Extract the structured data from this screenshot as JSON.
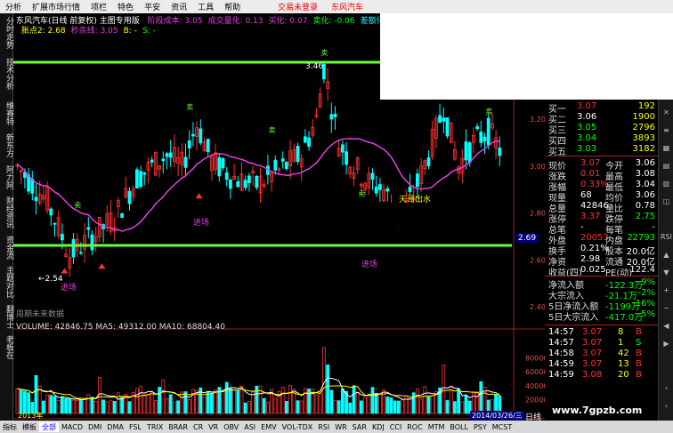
{
  "menu": {
    "items": [
      "分析",
      "扩展市场行情",
      "项栏",
      "特色",
      "平安",
      "资讯",
      "工具",
      "帮助"
    ],
    "right_items": [
      "交易未登录",
      "东风汽车"
    ]
  },
  "left_tabs": [
    "分时走势",
    "技术分析",
    "维赛特",
    "新东方",
    "阿力阿",
    "财经资讯",
    "资金流",
    "主题对比",
    "翻博士",
    "老板在"
  ],
  "chart": {
    "title": "东风汽车(日线 前复权) 主图专用版",
    "indicators_line1": [
      {
        "label": "阶段成本: 3.05",
        "color": "#e040e0"
      },
      {
        "label": "成交量化: 0.13",
        "color": "#e040e0"
      },
      {
        "label": "买化: 0.07",
        "color": "#e040e0"
      },
      {
        "label": "卖化: -0.06",
        "color": "#00ff00"
      },
      {
        "label": "差额化: 0.13",
        "color": "#00ffff"
      },
      {
        "label": "买卖额比: 1.33",
        "color": "#ffffff"
      },
      {
        "label": "项",
        "color": "#ffffff"
      }
    ],
    "indicators_line2": [
      {
        "label": "胀点2: 2.68",
        "color": "#ffff00"
      },
      {
        "label": "秒杀线: 3.05",
        "color": "#e040e0"
      },
      {
        "label": "B: -",
        "color": "#ffff00"
      },
      {
        "label": "S: -",
        "color": "#00ff00"
      }
    ],
    "price_axis": [
      "3.20",
      "3.00",
      "2.80",
      "2.69",
      "2.60",
      "2.40"
    ],
    "annotations": {
      "high": "3.46",
      "low": "←2.54",
      "entry1": "进场",
      "entry2": "进场",
      "exit": "天哥出水",
      "future": "周期未来数据",
      "buy_label": "买",
      "sell_label": "卖"
    },
    "volume_label": "VOLUME: 42846.75  MA5: 49312.00  MA10: 68804.40",
    "volume_axis": [
      "80000",
      "60000",
      "40000",
      "20000"
    ],
    "date_start": "2013年",
    "date_end": "2014/03/26/三",
    "period": "日线"
  },
  "quote": {
    "order_book": [
      {
        "label": "买一",
        "price": "3.07",
        "vol": "192"
      },
      {
        "label": "买二",
        "price": "3.06",
        "vol": "1900"
      },
      {
        "label": "买三",
        "price": "3.05",
        "vol": "2796"
      },
      {
        "label": "买四",
        "price": "3.04",
        "vol": "3893"
      },
      {
        "label": "买五",
        "price": "3.03",
        "vol": "3182"
      }
    ],
    "stats": [
      {
        "l1": "现价",
        "v1": "3.07",
        "l2": "今开",
        "v2": "3.06"
      },
      {
        "l1": "涨跌",
        "v1": "0.01",
        "l2": "最高",
        "v2": "3.08"
      },
      {
        "l1": "涨幅",
        "v1": "0.33%",
        "l2": "最低",
        "v2": "3.04"
      },
      {
        "l1": "现量",
        "v1": "68",
        "l2": "均价",
        "v2": "3.06"
      },
      {
        "l1": "总量",
        "v1": "42846",
        "l2": "量比",
        "v2": "0.78"
      },
      {
        "l1": "涨停",
        "v1": "3.37",
        "l2": "跌停",
        "v2": "2.75"
      },
      {
        "l1": "总笔",
        "v1": "-",
        "l2": "每笔",
        "v2": "-"
      },
      {
        "l1": "外盘",
        "v1": "20053",
        "l2": "内盘",
        "v2": "22793"
      },
      {
        "l1": "换手",
        "v1": "0.21%",
        "l2": "股本",
        "v2": "20.0亿"
      },
      {
        "l1": "净资",
        "v1": "2.98",
        "l2": "流通",
        "v2": "20.0亿"
      },
      {
        "l1": "收益(四)",
        "v1": "0.025",
        "l2": "PE(动)",
        "v2": "122.4"
      }
    ],
    "flows": [
      {
        "label": "净流入额",
        "v": "-122.3万",
        "p": "-9%"
      },
      {
        "label": "大宗流入",
        "v": "-21.1万",
        "p": "-2%"
      },
      {
        "label": "5日净流入额",
        "v": "-1199万",
        "p": "-16%"
      },
      {
        "label": "5日大宗流入",
        "v": "-417.0万",
        "p": "-5%"
      }
    ],
    "ticks": [
      {
        "time": "14:57",
        "price": "3.07",
        "vol": "8",
        "side": "B"
      },
      {
        "time": "14:57",
        "price": "3.07",
        "vol": "1",
        "side": "S"
      },
      {
        "time": "14:58",
        "price": "3.07",
        "vol": "42",
        "side": "B"
      },
      {
        "time": "14:59",
        "price": "3.07",
        "vol": "13",
        "side": "B"
      },
      {
        "time": "14:59",
        "price": "3.08",
        "vol": "20",
        "side": "B"
      }
    ]
  },
  "bottom_tabs": [
    "指标",
    "模板",
    "全部",
    "MACD",
    "DMI",
    "DMA",
    "FSL",
    "TRIX",
    "BRAR",
    "CR",
    "VR",
    "OBV",
    "ASI",
    "EMV",
    "VOL-TDX",
    "RSI",
    "WR",
    "SAR",
    "KDJ",
    "CCI",
    "ROC",
    "MTM",
    "BOLL",
    "PSY",
    "MCST"
  ],
  "watermark": "www.7gpzb.com",
  "colors": {
    "up": "#ff3030",
    "down": "#00ffff",
    "ma": "#e040e0",
    "green_line": "#66ff33",
    "volume_up": "#ff3030",
    "volume_down": "#00ffff"
  }
}
